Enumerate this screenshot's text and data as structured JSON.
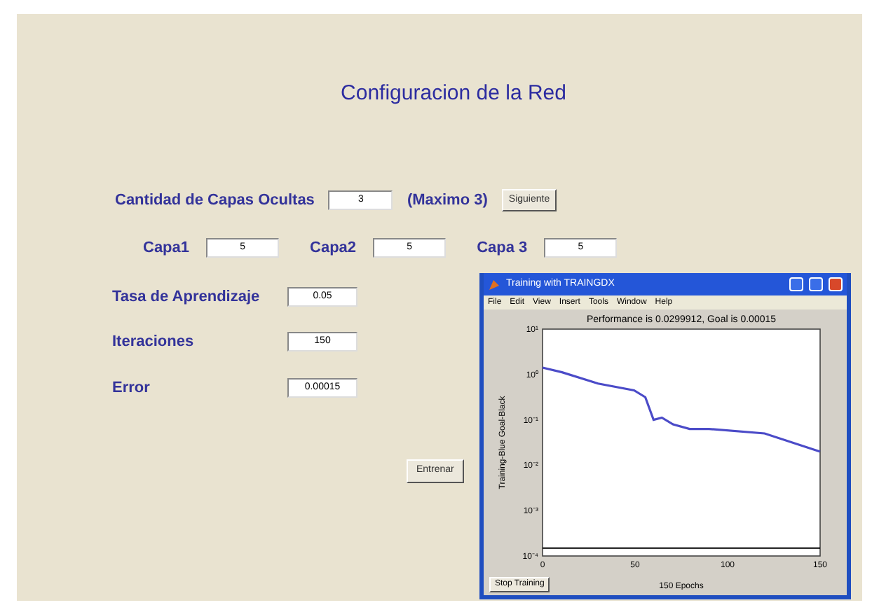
{
  "heading": "Configuracion de la Red",
  "hidden_layers": {
    "label": "Cantidad de Capas Ocultas",
    "value": "3",
    "note": "(Maximo 3)",
    "button": "Siguiente"
  },
  "layers": [
    {
      "label": "Capa1",
      "value": "5"
    },
    {
      "label": "Capa2",
      "value": "5"
    },
    {
      "label": "Capa 3",
      "value": "5"
    }
  ],
  "params": [
    {
      "label": "Tasa de Aprendizaje",
      "value": "0.05"
    },
    {
      "label": "Iteraciones",
      "value": "150"
    },
    {
      "label": "Error",
      "value": "0.00015"
    }
  ],
  "train_button": "Entrenar",
  "figure": {
    "title": "Training with TRAINGDX",
    "menu": [
      "File",
      "Edit",
      "View",
      "Insert",
      "Tools",
      "Window",
      "Help"
    ],
    "stop_button": "Stop Training",
    "plot": {
      "title": "Performance is 0.0299912, Goal is 0.00015",
      "xlabel": "150 Epochs",
      "ylabel": "Training-Blue  Goal-Black",
      "y_tick_labels": [
        "10¹",
        "10⁰",
        "10⁻¹",
        "10⁻²",
        "10⁻³",
        "10⁻⁴"
      ],
      "x_tick_labels": [
        "0",
        "50",
        "100",
        "150"
      ]
    }
  }
}
